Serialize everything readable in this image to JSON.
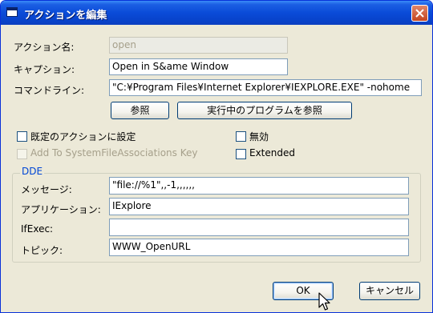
{
  "window": {
    "title": "アクションを編集"
  },
  "fields": {
    "action_name": {
      "label": "アクション名:",
      "value": "open"
    },
    "caption": {
      "label": "キャプション:",
      "value": "Open in S&ame Window"
    },
    "command_line": {
      "label": "コマンドライン:",
      "value": "\"C:¥Program Files¥Internet Explorer¥IEXPLORE.EXE\" -nohome"
    }
  },
  "buttons": {
    "browse": "参照",
    "browse_running": "実行中のプログラムを参照",
    "ok": "OK",
    "cancel": "キャンセル"
  },
  "checkboxes": {
    "set_default": {
      "label": "既定のアクションに設定",
      "checked": false
    },
    "disabled": {
      "label": "無効",
      "checked": false
    },
    "add_sfa": {
      "label": "Add To SystemFileAssociations Key",
      "checked": false,
      "enabled": false
    },
    "extended": {
      "label": "Extended",
      "checked": false
    }
  },
  "dde": {
    "title": "DDE",
    "message": {
      "label": "メッセージ:",
      "value": "\"file://%1\",,-1,,,,,,"
    },
    "application": {
      "label": "アプリケーション:",
      "value": "IExplore"
    },
    "ifexec": {
      "label": "IfExec:",
      "value": ""
    },
    "topic": {
      "label": "トピック:",
      "value": "WWW_OpenURL"
    }
  },
  "colors": {
    "titlebar": "#0a4bd8",
    "dialog_bg": "#ece9d8",
    "group_title": "#0046d5",
    "close_button": "#c4451f"
  },
  "icons": [
    "window-icon",
    "close-icon",
    "mouse-cursor-icon"
  ]
}
